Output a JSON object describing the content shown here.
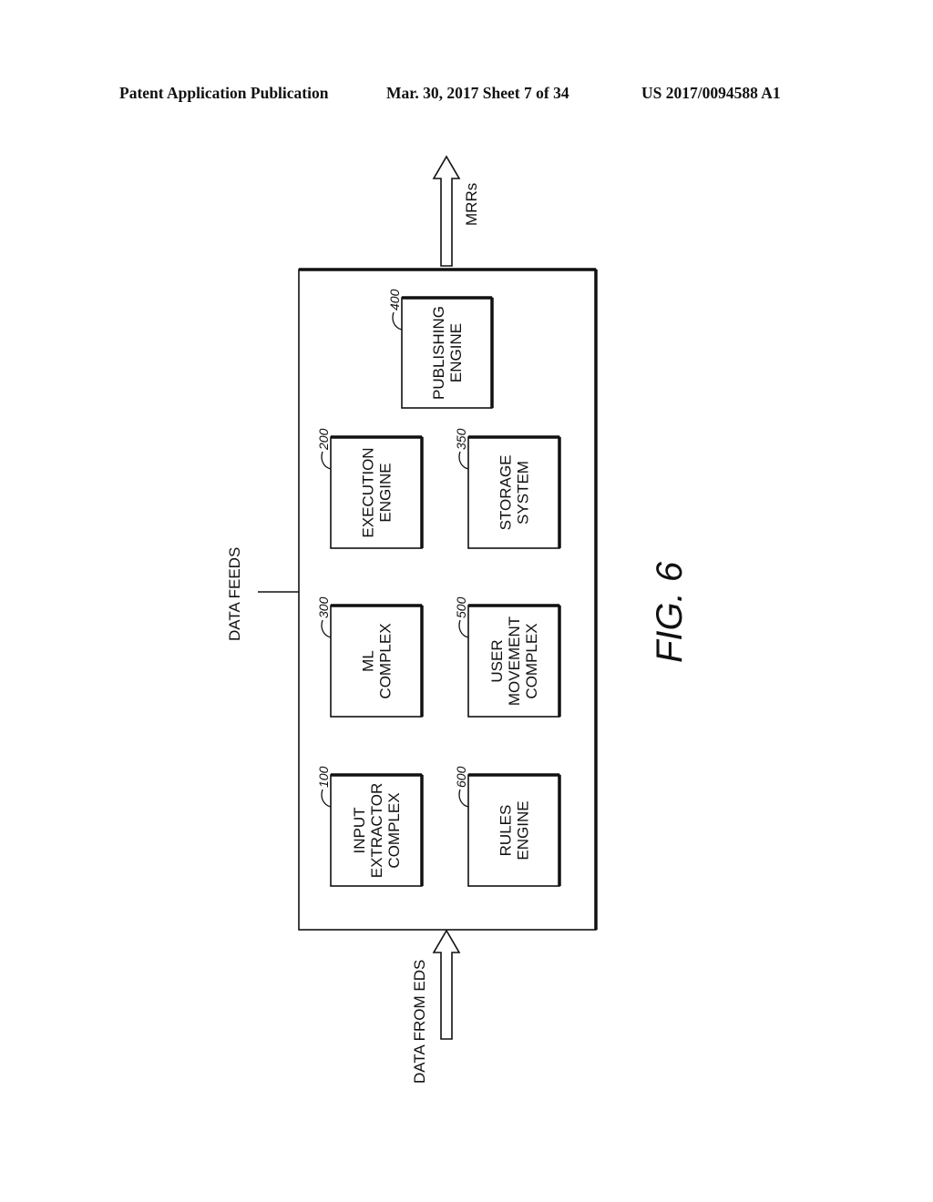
{
  "header": {
    "publication": "Patent Application Publication",
    "date_sheet": "Mar. 30, 2017  Sheet 7 of 34",
    "patent_number": "US 2017/0094588 A1"
  },
  "figure_label": "FIG. 6",
  "arrows": {
    "output": "MRRs",
    "input": "DATA FROM EDS"
  },
  "data_feeds_label": "DATA FEEDS",
  "blocks": [
    {
      "id": "publishing",
      "ref": "400",
      "lines": [
        "PUBLISHING",
        "ENGINE"
      ]
    },
    {
      "id": "execution",
      "ref": "200",
      "lines": [
        "EXECUTION",
        "ENGINE"
      ]
    },
    {
      "id": "storage",
      "ref": "350",
      "lines": [
        "STORAGE",
        "SYSTEM"
      ]
    },
    {
      "id": "ml",
      "ref": "300",
      "lines": [
        "ML",
        "COMPLEX"
      ]
    },
    {
      "id": "user-movement",
      "ref": "500",
      "lines": [
        "USER",
        "MOVEMENT",
        "COMPLEX"
      ]
    },
    {
      "id": "input-extractor",
      "ref": "100",
      "lines": [
        "INPUT",
        "EXTRACTOR",
        "COMPLEX"
      ]
    },
    {
      "id": "rules",
      "ref": "600",
      "lines": [
        "RULES",
        "ENGINE"
      ]
    }
  ]
}
